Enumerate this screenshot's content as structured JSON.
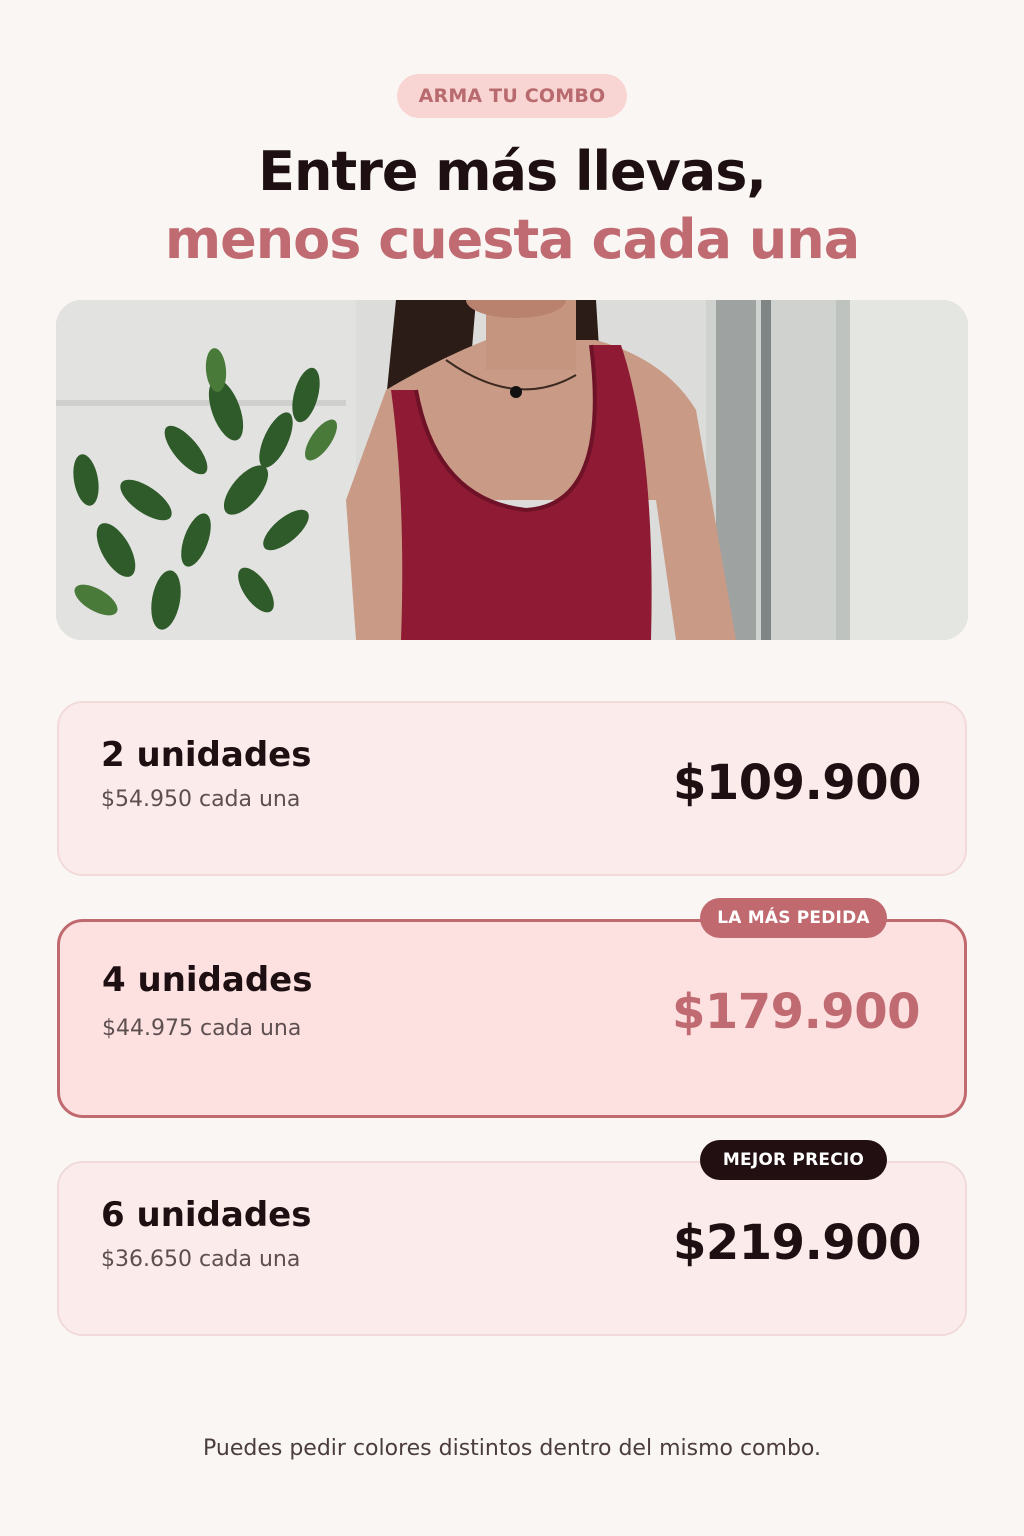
{
  "header": {
    "eyebrow": "ARMA TU COMBO",
    "title_line1": "Entre más llevas,",
    "title_line2": "menos cuesta cada una"
  },
  "hero": {
    "garment_color": "#8e1a33"
  },
  "combos": [
    {
      "quantity": "2 unidades",
      "unit_price": "$54.950 cada una",
      "total": "$109.900",
      "badge": ""
    },
    {
      "quantity": "4 unidades",
      "unit_price": "$44.975 cada una",
      "total": "$179.900",
      "badge": "LA MÁS PEDIDA"
    },
    {
      "quantity": "6 unidades",
      "unit_price": "$36.650 cada una",
      "total": "$219.900",
      "badge": "MEJOR PRECIO"
    }
  ],
  "footer": {
    "note": "Puedes pedir colores distintos dentro del mismo combo."
  },
  "colors": {
    "background": "#faf6f4",
    "accent": "#c06a71",
    "dark": "#1e1012",
    "card": "#fbeceb",
    "card_featured": "#fde1e0"
  }
}
